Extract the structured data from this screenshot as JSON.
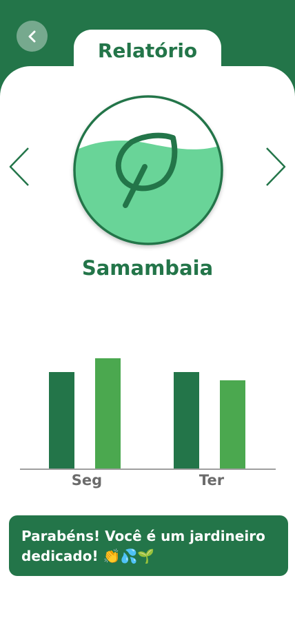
{
  "header": {
    "title": "Relatório"
  },
  "plant": {
    "name": "Samambaia"
  },
  "icons": {
    "back": "chevron-left-icon",
    "previous": "chevron-left-icon",
    "next": "chevron-right-icon",
    "plant": "leaf-icon"
  },
  "colors": {
    "primary": "#237549",
    "secondary": "#4ba84f",
    "water": "#69d498",
    "axis": "#9e9e9e",
    "tick_label": "#6b6b6b"
  },
  "chart_data": {
    "type": "bar",
    "categories": [
      "Seg",
      "Ter"
    ],
    "series": [
      {
        "values": [
          7,
          7
        ]
      },
      {
        "values": [
          8,
          6.4
        ]
      }
    ],
    "ylim": [
      0,
      10
    ],
    "xlabel": "",
    "ylabel": "",
    "grid": false
  },
  "message": {
    "text": "Parabéns! Você é um jardineiro dedicado! 👏💦🌱"
  }
}
